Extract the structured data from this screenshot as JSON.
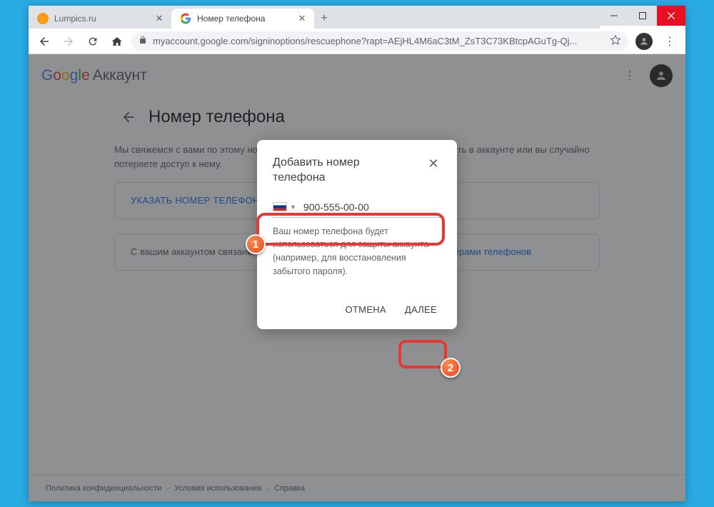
{
  "tabs": [
    {
      "title": "Lumpics.ru"
    },
    {
      "title": "Номер телефона"
    }
  ],
  "url": "myaccount.google.com/signinoptions/rescuephone?rapt=AEjHL4M6aC3tM_ZsT3C73KBtcpAGuTg-Qj...",
  "logo": {
    "google": "Google",
    "account": "Аккаунт"
  },
  "page": {
    "title": "Номер телефона",
    "desc": "Мы свяжемся с вами по этому номеру, если заметим подозрительную активность в аккаунте или вы случайно потеряете доступ к нему.",
    "card1_link": "УКАЗАТЬ НОМЕР ТЕЛЕФОНА",
    "card2_text": "С вашим аккаунтом связаны и другие номера телефонов. ",
    "card2_link": "Управление номерами телефонов"
  },
  "modal": {
    "title": "Добавить номер телефона",
    "phone": "900-555-00-00",
    "text": "Ваш номер телефона будет использоваться для защиты аккаунта (например, для восстановления забытого пароля).",
    "cancel": "ОТМЕНА",
    "next": "ДАЛЕЕ"
  },
  "footer": {
    "privacy": "Политика конфиденциальности",
    "terms": "Условия использования",
    "help": "Справка"
  },
  "annotations": {
    "n1": "1",
    "n2": "2"
  }
}
